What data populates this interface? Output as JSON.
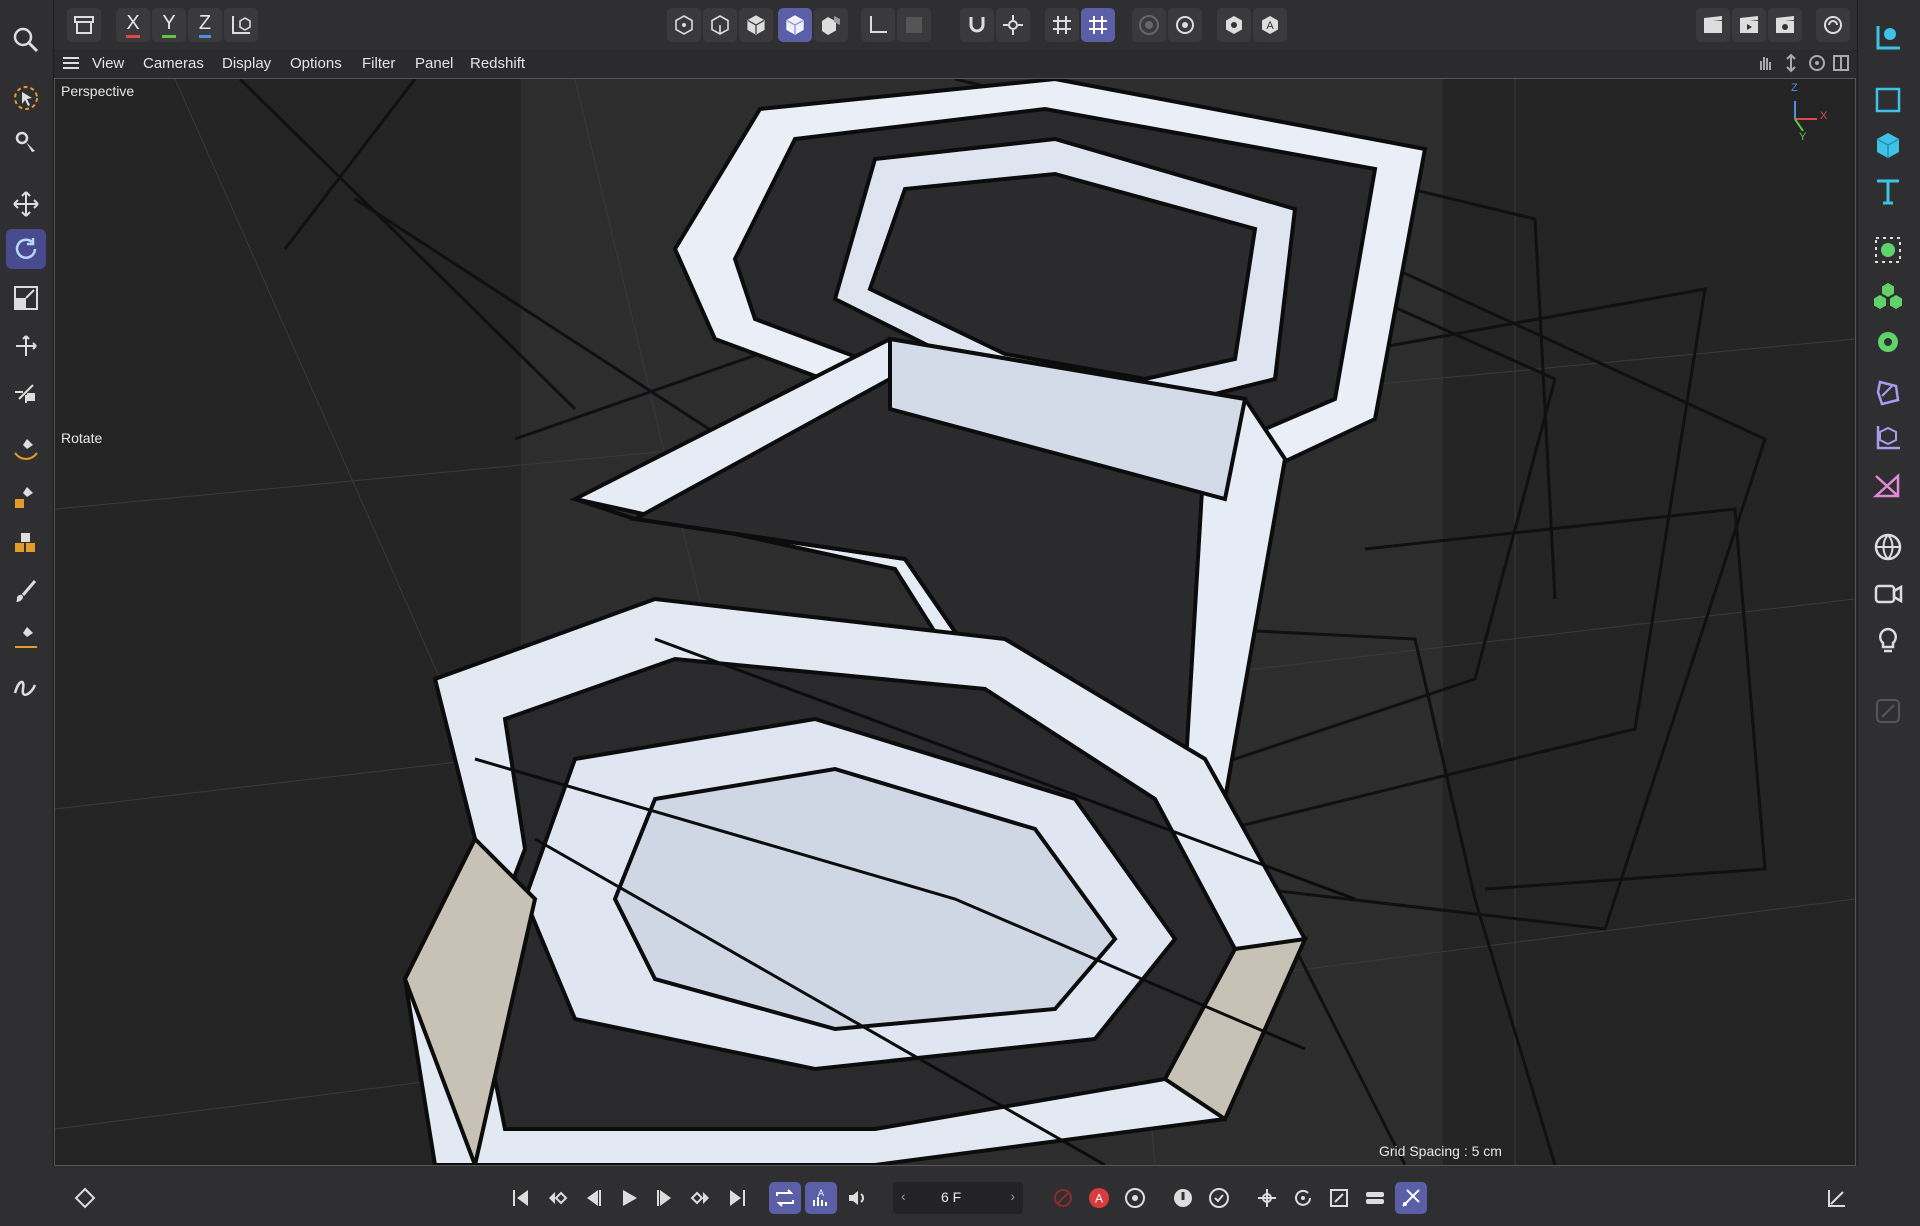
{
  "toolbar": {
    "axis_x": "X",
    "axis_y": "Y",
    "axis_z": "Z"
  },
  "menu": {
    "items": [
      "View",
      "Cameras",
      "Display",
      "Options",
      "Filter",
      "Panel",
      "Redshift"
    ]
  },
  "viewport": {
    "camera_label": "Perspective",
    "tool_label": "Rotate",
    "grid_spacing": "Grid Spacing : 5 cm",
    "gizmo_z": "Z",
    "gizmo_x": "X",
    "gizmo_y": "Y"
  },
  "timeline": {
    "current_frame": "6 F"
  },
  "colors": {
    "accent": "#5a5fa8",
    "axis_x": "#e0464b",
    "axis_y": "#67c24a",
    "axis_z": "#4d8fe6",
    "record": "#d83c3c",
    "cyan_icon": "#3ec3e8",
    "green_icon": "#5fd36a",
    "pink_icon": "#e08ad8"
  }
}
